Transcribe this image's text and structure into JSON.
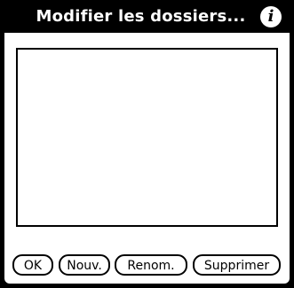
{
  "dialog": {
    "title": "Modifier les dossiers...",
    "info_icon": "info-icon"
  },
  "folder_list": {
    "items": []
  },
  "buttons": {
    "ok": "OK",
    "new": "Nouv.",
    "rename": "Renom.",
    "delete": "Supprimer"
  },
  "colors": {
    "titlebar": "#000000",
    "background": "#ffffff",
    "border": "#000000"
  }
}
